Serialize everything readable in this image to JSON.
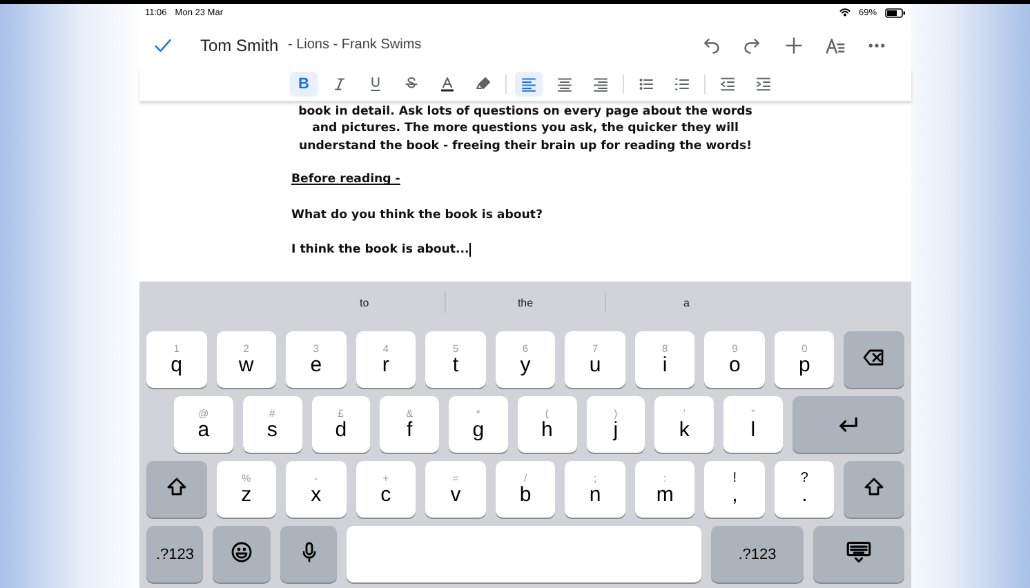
{
  "status_bar": {
    "time": "11:06",
    "date": "Mon 23 Mar",
    "battery": "69%"
  },
  "title_bar": {
    "doc_owner": "Tom Smith",
    "doc_title": " - Lions - Frank Swims",
    "actions": [
      {
        "kind": "undo"
      },
      {
        "kind": "redo"
      },
      {
        "kind": "add"
      },
      {
        "kind": "format"
      },
      {
        "kind": "more"
      }
    ]
  },
  "format_toolbar": [
    [
      {
        "kind": "bold",
        "label": "B",
        "selected": true
      },
      {
        "kind": "italic",
        "selected": false
      },
      {
        "kind": "underline",
        "selected": false
      },
      {
        "kind": "strike",
        "selected": false
      },
      {
        "kind": "text-color",
        "selected": false
      },
      {
        "kind": "highlight",
        "selected": false
      }
    ],
    [
      {
        "kind": "align-left",
        "selected": true
      },
      {
        "kind": "align-center",
        "selected": false
      },
      {
        "kind": "align-right",
        "selected": false
      }
    ],
    [
      {
        "kind": "bullets",
        "selected": false
      },
      {
        "kind": "numbers",
        "selected": false
      }
    ],
    [
      {
        "kind": "outdent",
        "selected": false
      },
      {
        "kind": "indent",
        "selected": false
      }
    ]
  ],
  "document": {
    "paragraphs": [
      {
        "kind": "centered",
        "text": "book in detail. Ask lots of questions on every page about the words"
      },
      {
        "kind": "centered",
        "text": "and pictures. The more questions you ask, the quicker they will"
      },
      {
        "kind": "centered",
        "text": "understand the book - freeing their brain up for reading the words!"
      },
      {
        "kind": "heading",
        "text": "Before reading -"
      },
      {
        "kind": "body",
        "text": "What do you think the book is about?"
      },
      {
        "kind": "body",
        "text": "I think the book is about..."
      }
    ]
  },
  "suggestions": [
    "to",
    "the",
    "a"
  ],
  "keyboard": [
    [
      {
        "kind": "letter",
        "label": "q",
        "alt": "1"
      },
      {
        "kind": "letter",
        "label": "w",
        "alt": "2"
      },
      {
        "kind": "letter",
        "label": "e",
        "alt": "3"
      },
      {
        "kind": "letter",
        "label": "r",
        "alt": "4"
      },
      {
        "kind": "letter",
        "label": "t",
        "alt": "5"
      },
      {
        "kind": "letter",
        "label": "y",
        "alt": "6"
      },
      {
        "kind": "letter",
        "label": "u",
        "alt": "7"
      },
      {
        "kind": "letter",
        "label": "i",
        "alt": "8"
      },
      {
        "kind": "letter",
        "label": "o",
        "alt": "9"
      },
      {
        "kind": "letter",
        "label": "p",
        "alt": "0"
      },
      {
        "kind": "delete"
      }
    ],
    [
      {
        "kind": "letter",
        "label": "a",
        "alt": "@"
      },
      {
        "kind": "letter",
        "label": "s",
        "alt": "#"
      },
      {
        "kind": "letter",
        "label": "d",
        "alt": "£"
      },
      {
        "kind": "letter",
        "label": "f",
        "alt": "&"
      },
      {
        "kind": "letter",
        "label": "g",
        "alt": "*"
      },
      {
        "kind": "letter",
        "label": "h",
        "alt": "("
      },
      {
        "kind": "letter",
        "label": "j",
        "alt": ")"
      },
      {
        "kind": "letter",
        "label": "k",
        "alt": "’"
      },
      {
        "kind": "letter",
        "label": "l",
        "alt": "”"
      },
      {
        "kind": "return"
      }
    ],
    [
      {
        "kind": "shift"
      },
      {
        "kind": "letter",
        "label": "z",
        "alt": "%"
      },
      {
        "kind": "letter",
        "label": "x",
        "alt": "-"
      },
      {
        "kind": "letter",
        "label": "c",
        "alt": "+"
      },
      {
        "kind": "letter",
        "label": "v",
        "alt": "="
      },
      {
        "kind": "letter",
        "label": "b",
        "alt": "/"
      },
      {
        "kind": "letter",
        "label": "n",
        "alt": ";"
      },
      {
        "kind": "letter",
        "label": "m",
        "alt": ":"
      },
      {
        "kind": "letter",
        "label": ",",
        "alt": "!",
        "dark_alt": true
      },
      {
        "kind": "letter",
        "label": ".",
        "alt": "?",
        "dark_alt": true
      },
      {
        "kind": "shift"
      }
    ],
    [
      {
        "kind": "numbers",
        "label": ".?123"
      },
      {
        "kind": "emoji"
      },
      {
        "kind": "mic"
      },
      {
        "kind": "space"
      },
      {
        "kind": "numbers",
        "label": ".?123"
      },
      {
        "kind": "dismiss"
      }
    ]
  ]
}
